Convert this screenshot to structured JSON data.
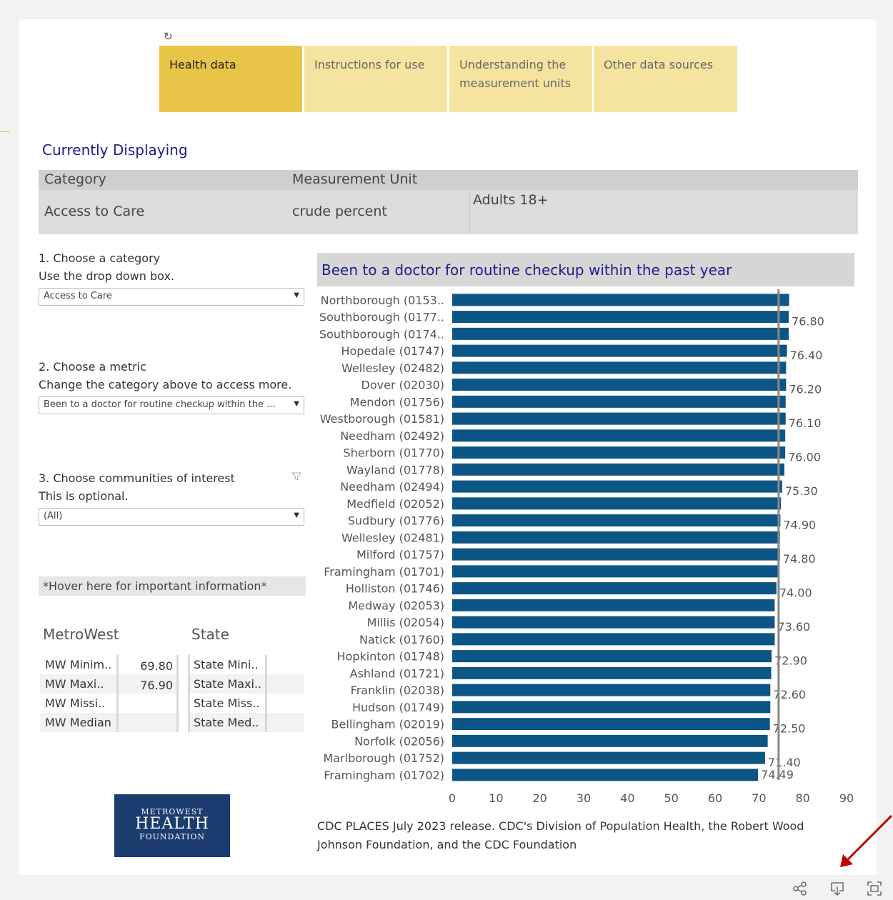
{
  "tabs": [
    {
      "label": "Health data",
      "active": true
    },
    {
      "label": "Instructions for use",
      "active": false
    },
    {
      "label": "Understanding the measurement units",
      "active": false
    },
    {
      "label": "Other data sources",
      "active": false
    }
  ],
  "currently_displaying": {
    "title": "Currently Displaying",
    "category_header": "Category",
    "measurement_header": "Measurement Unit",
    "category_value": "Access to Care",
    "measurement_value": "crude percent",
    "population_value": "Adults 18+"
  },
  "controls": {
    "step1_label": "1. Choose a category",
    "step1_hint": "Use the drop down box.",
    "step1_value": "Access to Care",
    "step2_label": "2. Choose a metric",
    "step2_hint": "Change the category above to access more.",
    "step2_value": "Been to a doctor for routine checkup within the ...",
    "step3_label": "3. Choose communities of interest",
    "step3_hint": "This is optional.",
    "step3_value": "(All)",
    "hover_info": "*Hover here for important information*"
  },
  "stats": {
    "metrowest_header": "MetroWest",
    "state_header": "State",
    "mw_rows": [
      {
        "label": "MW Minim..",
        "value": "69.80"
      },
      {
        "label": "MW Maxi..",
        "value": "76.90"
      },
      {
        "label": "MW Missi..",
        "value": ""
      },
      {
        "label": "MW Median",
        "value": ""
      }
    ],
    "state_rows": [
      {
        "label": "State Mini..",
        "value": ""
      },
      {
        "label": "State Maxi..",
        "value": ""
      },
      {
        "label": "State Miss..",
        "value": ""
      },
      {
        "label": "State Med..",
        "value": ""
      }
    ]
  },
  "chart_data": {
    "type": "bar",
    "orientation": "horizontal",
    "title": "Been to a doctor for routine checkup within the past year",
    "categories": [
      "Northborough (0153..",
      "Southborough (0177..",
      "Southborough (0174..",
      "Hopedale (01747)",
      "Wellesley (02482)",
      "Dover (02030)",
      "Mendon (01756)",
      "Westborough (01581)",
      "Needham (02492)",
      "Sherborn (01770)",
      "Wayland (01778)",
      "Needham (02494)",
      "Medfield (02052)",
      "Sudbury (01776)",
      "Wellesley (02481)",
      "Milford (01757)",
      "Framingham (01701)",
      "Holliston (01746)",
      "Medway (02053)",
      "Millis (02054)",
      "Natick (01760)",
      "Hopkinton (01748)",
      "Ashland (01721)",
      "Franklin (02038)",
      "Hudson (01749)",
      "Bellingham (02019)",
      "Norfolk (02056)",
      "Marlborough (01752)",
      "Framingham (01702)"
    ],
    "values": [
      76.9,
      76.8,
      76.8,
      76.4,
      76.2,
      76.2,
      76.1,
      76.1,
      76.0,
      76.0,
      75.8,
      75.3,
      75.0,
      74.9,
      74.8,
      74.8,
      74.5,
      74.0,
      73.6,
      73.6,
      73.6,
      72.9,
      72.8,
      72.6,
      72.6,
      72.5,
      72.0,
      71.4,
      69.8
    ],
    "data_labels": [
      "",
      "76.80",
      "",
      "76.40",
      "",
      "76.20",
      "",
      "76.10",
      "",
      "76.00",
      "",
      "75.30",
      "",
      "74.90",
      "",
      "74.80",
      "",
      "74.00",
      "",
      "73.60",
      "",
      "72.90",
      "",
      "72.60",
      "",
      "72.50",
      "",
      "71.40",
      "74.49"
    ],
    "reference_line": {
      "value": 74.49
    },
    "xlim": [
      0,
      90
    ],
    "xticks": [
      0,
      10,
      20,
      30,
      40,
      50,
      60,
      70,
      80,
      90
    ],
    "bar_color": "#0d5585",
    "grid": false
  },
  "source_text": "CDC PLACES  July 2023 release. CDC's Division of Population Health, the Robert Wood Johnson Foundation, and the CDC Foundation",
  "logo": {
    "line1": "METROWEST",
    "line2": "HEALTH",
    "line3": "FOUNDATION"
  },
  "colors": {
    "tab_active": "#e9c547",
    "tab_inactive": "#f5e4a0",
    "title_blue": "#1e1e8c",
    "bar": "#0d5585",
    "arrow": "#c00000"
  }
}
